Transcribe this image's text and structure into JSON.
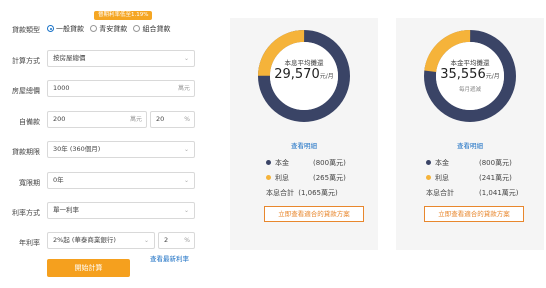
{
  "form": {
    "loan_type_label": "貸款類型",
    "loan_types": [
      "一般貸款",
      "青安貸款",
      "組合貸款"
    ],
    "promo_badge": "晉期利率低至1.19%",
    "calc_method_label": "計算方式",
    "calc_method_value": "按房屋總價",
    "house_price_label": "房屋總價",
    "house_price_value": "1000",
    "house_price_unit": "萬元",
    "down_payment_label": "自備款",
    "down_payment_value": "200",
    "down_payment_unit": "萬元",
    "down_payment_pct_value": "20",
    "down_payment_pct_unit": "%",
    "term_label": "貸款期限",
    "term_value": "30年 (360個月)",
    "grace_label": "寬限期",
    "grace_value": "0年",
    "rate_method_label": "利率方式",
    "rate_method_value": "單一利率",
    "annual_rate_label": "年利率",
    "annual_rate_value": "2%起 (華泰商業銀行)",
    "annual_rate_pct_value": "2",
    "annual_rate_pct_unit": "%",
    "latest_rate_link": "查看最新利率",
    "submit_label": "開始計算"
  },
  "results": [
    {
      "caption": "本息平均攤還",
      "amount": "29,570",
      "amount_unit": "元/月",
      "sub_caption": "",
      "detail_link": "查看明細",
      "principal_label": "本金",
      "principal_value": "(800萬元)",
      "interest_label": "利息",
      "interest_value": "(265萬元)",
      "total_label": "本息合計",
      "total_value": "(1,065萬元)",
      "cta_label": "立即查看適合的貸款方案",
      "interest_fraction": 0.249
    },
    {
      "caption": "本金平均攤還",
      "amount": "35,556",
      "amount_unit": "元/月",
      "sub_caption": "每月遞減",
      "detail_link": "查看明細",
      "principal_label": "本金",
      "principal_value": "(800萬元)",
      "interest_label": "利息",
      "interest_value": "(241萬元)",
      "total_label": "本息合計",
      "total_value": "(1,041萬元)",
      "cta_label": "立即查看適合的貸款方案",
      "interest_fraction": 0.231
    }
  ],
  "colors": {
    "principal": "#3a4466",
    "interest": "#f5b33a",
    "accent": "#f5a01e",
    "link": "#1a6fc4"
  }
}
